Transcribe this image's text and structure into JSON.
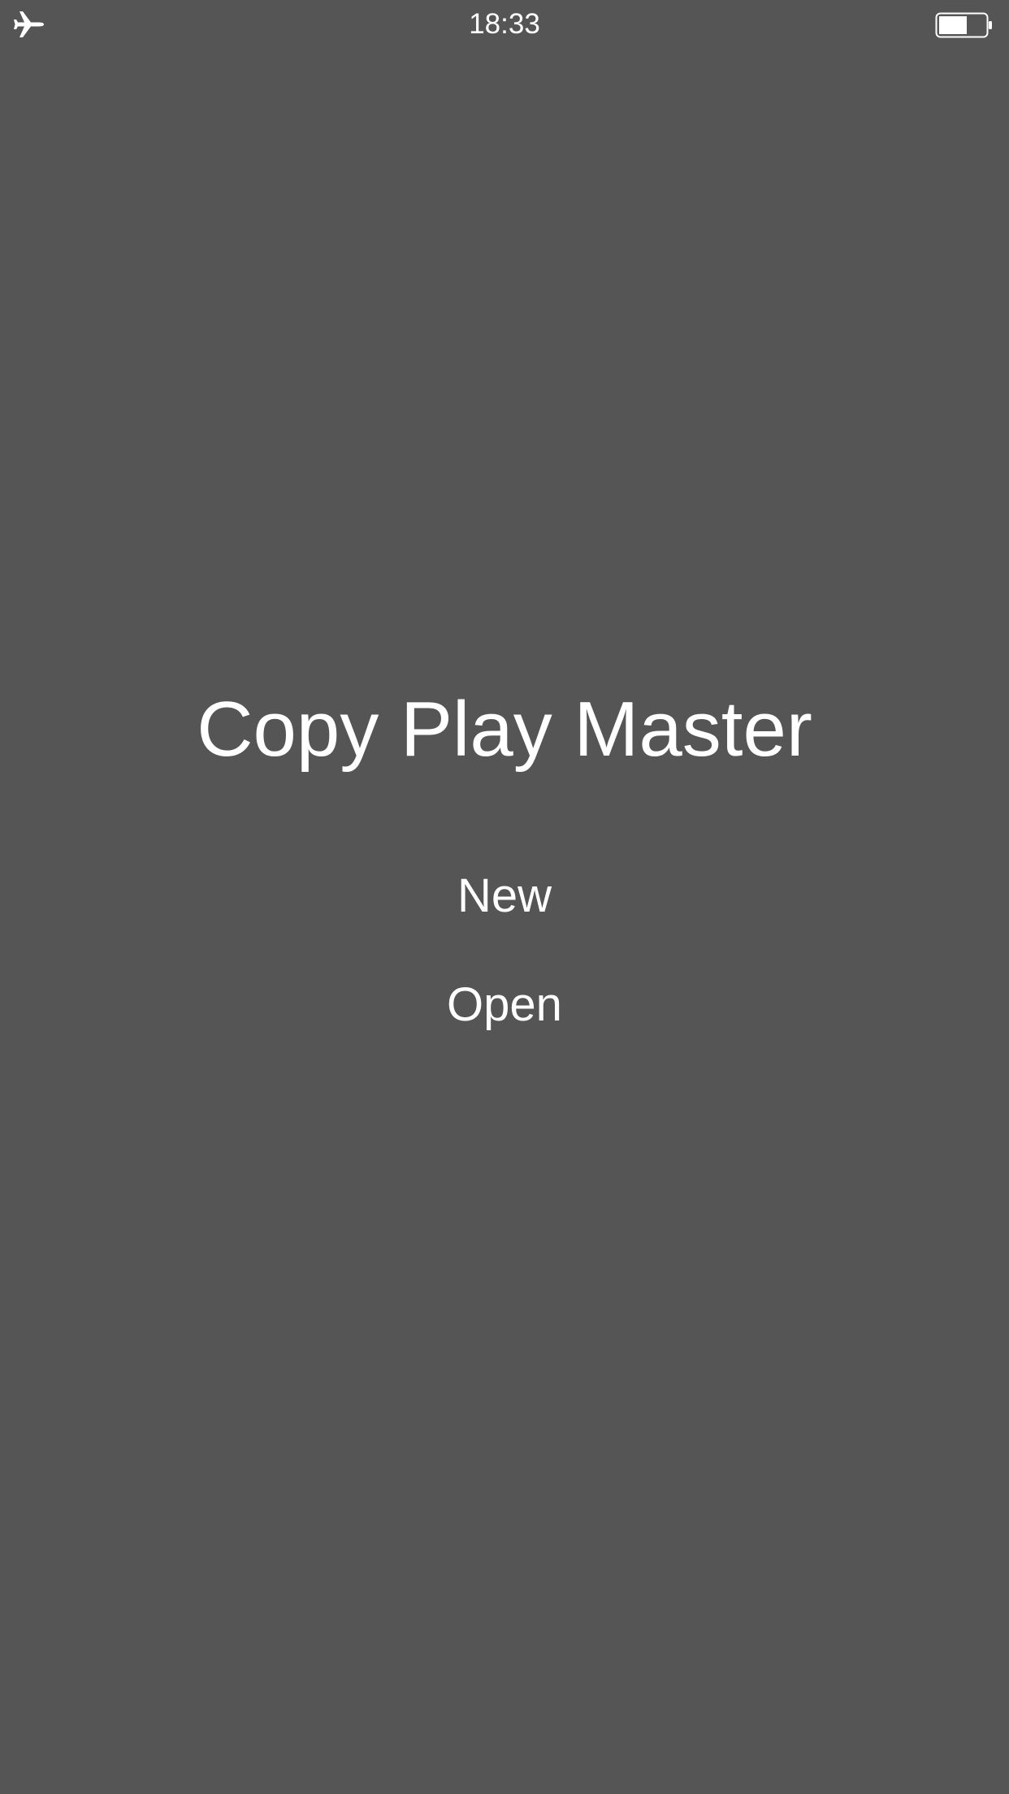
{
  "status_bar": {
    "time": "18:33",
    "left_icon": "airplane-icon",
    "right_icon": "battery-icon",
    "battery_level": 0.6
  },
  "main": {
    "title": "Copy Play Master",
    "buttons": {
      "new_label": "New",
      "open_label": "Open"
    }
  },
  "colors": {
    "background": "#555555",
    "foreground": "#ffffff"
  }
}
